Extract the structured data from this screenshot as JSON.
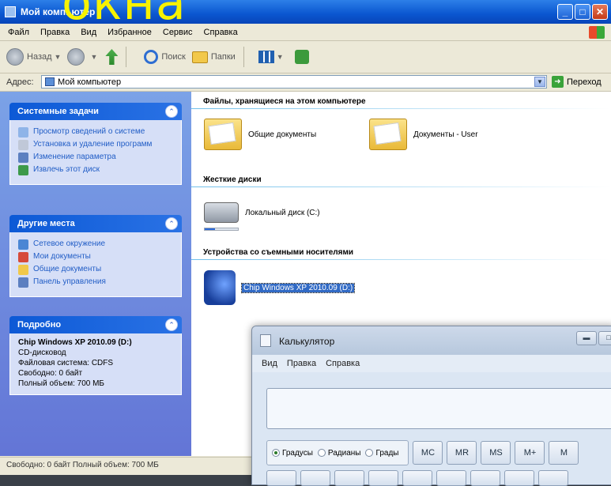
{
  "slide_title": "окна",
  "explorer": {
    "title": "Мой компьютер",
    "menu": [
      "Файл",
      "Правка",
      "Вид",
      "Избранное",
      "Сервис",
      "Справка"
    ],
    "toolbar": {
      "back": "Назад",
      "search": "Поиск",
      "folders": "Папки"
    },
    "address": {
      "label": "Адрес:",
      "value": "Мой компьютер",
      "go": "Переход"
    },
    "panels": {
      "system_tasks": {
        "title": "Системные задачи",
        "items": [
          "Просмотр сведений о системе",
          "Установка и удаление программ",
          "Изменение параметра",
          "Извлечь этот диск"
        ]
      },
      "other_places": {
        "title": "Другие места",
        "items": [
          "Сетевое окружение",
          "Мои документы",
          "Общие документы",
          "Панель управления"
        ]
      },
      "details": {
        "title": "Подробно",
        "name": "Chip Windows XP 2010.09 (D:)",
        "type": "CD-дисковод",
        "fs": "Файловая система: CDFS",
        "free": "Свободно: 0 байт",
        "total": "Полный объем: 700 МБ"
      }
    },
    "groups": {
      "files": {
        "title": "Файлы, хранящиеся на этом компьютере",
        "items": [
          "Общие документы",
          "Документы - User"
        ]
      },
      "hard_disks": {
        "title": "Жесткие диски",
        "items": [
          "Локальный диск (C:)"
        ],
        "free_fraction": 0.3
      },
      "removable": {
        "title": "Устройства со съемными носителями",
        "items": [
          "Chip Windows XP 2010.09 (D:)"
        ]
      }
    },
    "status": "Свободно: 0 байт Полный объем: 700 МБ"
  },
  "calculator": {
    "title": "Калькулятор",
    "menu": [
      "Вид",
      "Правка",
      "Справка"
    ],
    "angle_modes": [
      "Градусы",
      "Радианы",
      "Грады"
    ],
    "selected_mode": "Градусы",
    "memory_buttons": [
      "MC",
      "MR",
      "MS",
      "M+",
      "M"
    ]
  }
}
